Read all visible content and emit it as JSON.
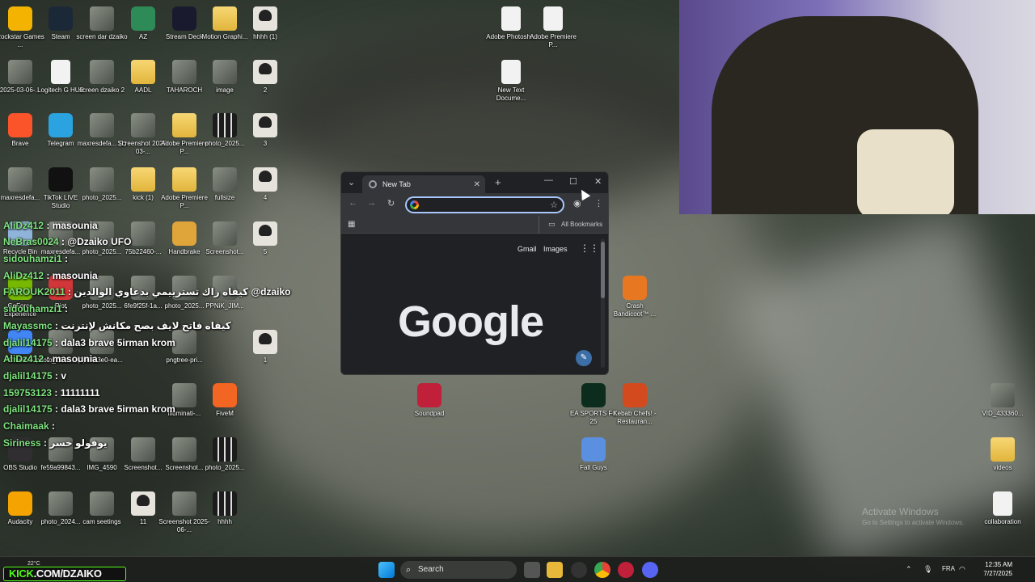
{
  "desktop_icons": [
    {
      "label": "Rockstar Games ...",
      "icon": "rockstar-icon"
    },
    {
      "label": "Steam",
      "icon": "steam-icon"
    },
    {
      "label": "screen dar dzaiko",
      "icon": "image-icon"
    },
    {
      "label": "AZ",
      "icon": "flag-image-icon"
    },
    {
      "label": "Stream Deck",
      "icon": "stream-deck-icon"
    },
    {
      "label": "Motion Graphi...",
      "icon": "folder-icon"
    },
    {
      "label": "hhhh (1)",
      "icon": "avatar-image-icon"
    },
    {
      "label": "2025-03-06-...",
      "icon": "image-icon"
    },
    {
      "label": "Logitech G HUB",
      "icon": "document-icon"
    },
    {
      "label": "screen dzaiko 2",
      "icon": "image-icon"
    },
    {
      "label": "AADL",
      "icon": "folder-icon"
    },
    {
      "label": "TAHAROCH",
      "icon": "image-icon"
    },
    {
      "label": "image",
      "icon": "image-icon"
    },
    {
      "label": "2",
      "icon": "avatar-image-icon"
    },
    {
      "label": "Brave",
      "icon": "brave-icon"
    },
    {
      "label": "Telegram",
      "icon": "telegram-icon"
    },
    {
      "label": "maxresdefa... (1)",
      "icon": "image-icon"
    },
    {
      "label": "Screenshot 2025-03-...",
      "icon": "image-icon"
    },
    {
      "label": "Adobe Premiere P...",
      "icon": "folder-icon"
    },
    {
      "label": "photo_2025...",
      "icon": "grid-image-icon"
    },
    {
      "label": "3",
      "icon": "avatar-image-icon"
    },
    {
      "label": "maxresdefa...",
      "icon": "image-icon"
    },
    {
      "label": "TikTok LIVE Studio",
      "icon": "tiktok-icon"
    },
    {
      "label": "photo_2025...",
      "icon": "image-icon"
    },
    {
      "label": "kick (1)",
      "icon": "folder-icon"
    },
    {
      "label": "Adobe Premiere P...",
      "icon": "folder-icon"
    },
    {
      "label": "fullsize",
      "icon": "image-icon"
    },
    {
      "label": "4",
      "icon": "avatar-image-icon"
    },
    {
      "label": "Recycle Bin",
      "icon": "recycle-bin-icon"
    },
    {
      "label": "maxresdefa...",
      "icon": "image-icon"
    },
    {
      "label": "photo_2025...",
      "icon": "image-icon"
    },
    {
      "label": "75b22460-...",
      "icon": "image-icon"
    },
    {
      "label": "Handbrake",
      "icon": "handbrake-icon"
    },
    {
      "label": "Screenshot...",
      "icon": "image-icon"
    },
    {
      "label": "5",
      "icon": "avatar-image-icon"
    },
    {
      "label": "GeForce Experience",
      "icon": "geforce-icon"
    },
    {
      "label": "Riot",
      "icon": "riot-icon"
    },
    {
      "label": "photo_2025...",
      "icon": "image-icon"
    },
    {
      "label": "6fe9f25f-1a...",
      "icon": "image-icon"
    },
    {
      "label": "photo_2025...",
      "icon": "image-icon"
    },
    {
      "label": "PPNiK_JIM...",
      "icon": "image-icon"
    },
    {
      "label": "Chrome",
      "icon": "chrome-icon"
    },
    {
      "label": "photo_2025... (2)",
      "icon": "image-icon"
    },
    {
      "label": "f46713e0-ea...",
      "icon": "image-icon"
    },
    {
      "label": "pngtree-pri...",
      "icon": "image-icon"
    },
    {
      "label": "1",
      "icon": "avatar-image-icon"
    },
    {
      "label": "illuminati-...",
      "icon": "image-icon"
    },
    {
      "label": "FiveM",
      "icon": "fivem-icon"
    },
    {
      "label": "OBS Studio",
      "icon": "obs-icon"
    },
    {
      "label": "fe59a99843...",
      "icon": "image-icon"
    },
    {
      "label": "IMG_4590",
      "icon": "image-icon"
    },
    {
      "label": "Screenshot...",
      "icon": "image-icon"
    },
    {
      "label": "Screenshot...",
      "icon": "image-icon"
    },
    {
      "label": "photo_2025...",
      "icon": "grid-image-icon"
    },
    {
      "label": "Audacity",
      "icon": "audacity-icon"
    },
    {
      "label": "photo_2024...",
      "icon": "image-icon"
    },
    {
      "label": "cam seetings",
      "icon": "image-icon"
    },
    {
      "label": "11",
      "icon": "avatar-image-icon"
    },
    {
      "label": "Screenshot 2025-06-...",
      "icon": "image-icon"
    },
    {
      "label": "hhhh",
      "icon": "grid-image-icon"
    },
    {
      "label": "Adobe Photosh...",
      "icon": "document-icon"
    },
    {
      "label": "Adobe Premiere P...",
      "icon": "document-icon"
    },
    {
      "label": "New Text Docume...",
      "icon": "document-icon"
    },
    {
      "label": "Crash Bandicoot™ ...",
      "icon": "crash-icon"
    },
    {
      "label": "Soundpad",
      "icon": "soundpad-icon"
    },
    {
      "label": "EA SPORTS FC 25",
      "icon": "fc25-icon"
    },
    {
      "label": "Kebab Chefs! - Restauran...",
      "icon": "kebab-chefs-icon"
    },
    {
      "label": "Fall Guys",
      "icon": "fall-guys-icon"
    },
    {
      "label": "VID_433360...",
      "icon": "image-icon"
    },
    {
      "label": "videos",
      "icon": "folder-icon"
    },
    {
      "label": "collaboration",
      "icon": "document-icon"
    }
  ],
  "chat": [
    {
      "user": "AliDz412",
      "text": " : masounia"
    },
    {
      "user": "NeBras0024",
      "text": " : @Dzaiko UFO"
    },
    {
      "user": "sidouhamzi1",
      "text": " : "
    },
    {
      "user": "AliDz412",
      "text": " : masounia"
    },
    {
      "user": "FAROUK2011",
      "text": " : كيفاه راك تسترييمي بدعاوي الوالدين @dzaiko"
    },
    {
      "user": "sidouhamzi1",
      "text": " : "
    },
    {
      "user": "Mayassmc",
      "text": " : كيفاه فاتح لايف بصح مكانش لإنترنت"
    },
    {
      "user": "djalil14175",
      "text": " : dala3 brave 5irman krom"
    },
    {
      "user": "AliDz412",
      "text": " : masounia"
    },
    {
      "user": "djalil14175",
      "text": " : v"
    },
    {
      "user": "159753123",
      "text": " : 11111111"
    },
    {
      "user": "djalil14175",
      "text": " : dala3 brave 5irman krom"
    },
    {
      "user": "Chaimaak",
      "text": " : "
    },
    {
      "user": "Siriness",
      "text": " : يوفولو خسر"
    }
  ],
  "browser": {
    "tab_title": "New Tab",
    "bookmarks_label": "All Bookmarks",
    "links": {
      "gmail": "Gmail",
      "images": "Images"
    },
    "logo_text": "Google",
    "omnibox_value": ""
  },
  "taskbar": {
    "kick_brand": "KICK",
    "kick_rest": ".COM/DZAIKO",
    "weather": "22°C",
    "search_placeholder": "Search",
    "lang": "FRA",
    "time": "12:35 AM",
    "date": "7/27/2025"
  },
  "watermark": {
    "title": "Activate Windows",
    "subtitle": "Go to Settings to activate Windows."
  },
  "colors": {
    "accent": "#a8c7fa",
    "kick_green": "#53fc18",
    "chat_user": "#7fe37f"
  }
}
